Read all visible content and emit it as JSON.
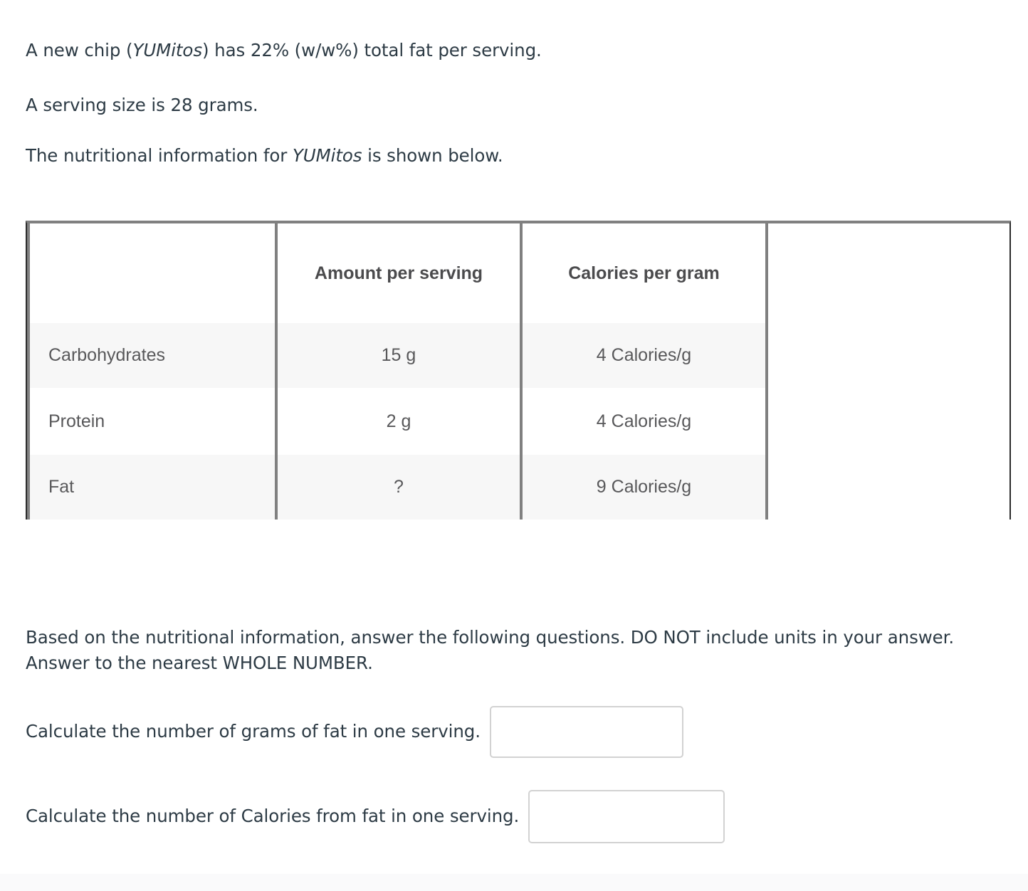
{
  "intro": {
    "line1_pre": "A new chip (",
    "line1_em": "YUMitos",
    "line1_post": ") has 22% (w/w%) total fat per serving.",
    "line2": "A serving size is 28 grams.",
    "line3_pre": "The nutritional information for ",
    "line3_em": "YUMitos",
    "line3_post": " is shown below."
  },
  "table": {
    "headers": [
      "",
      "Amount per serving",
      "Calories per gram",
      ""
    ],
    "rows": [
      {
        "nutrient": "Carbohydrates",
        "amount": "15 g",
        "calories_per_gram": "4 Calories/g",
        "extra": ""
      },
      {
        "nutrient": "Protein",
        "amount": "2 g",
        "calories_per_gram": "4 Calories/g",
        "extra": ""
      },
      {
        "nutrient": "Fat",
        "amount": "?",
        "calories_per_gram": "9 Calories/g",
        "extra": ""
      }
    ]
  },
  "instructions": "Based on the nutritional information, answer the following questions. DO NOT include units in your answer.  Answer to the nearest WHOLE NUMBER.",
  "questions": [
    {
      "label": "Calculate the number of grams of fat in one serving.",
      "value": "",
      "placeholder": ""
    },
    {
      "label": "Calculate the number of Calories from fat in one serving.",
      "value": "",
      "placeholder": ""
    }
  ],
  "colors": {
    "body_text": "#2d3b45",
    "table_text": "#58585a",
    "table_header_text": "#4b4b4d",
    "stripe": "#f7f7f7",
    "grid_line": "#808080",
    "table_border": "#2b2b2b",
    "input_border": "#d2d2d2"
  }
}
